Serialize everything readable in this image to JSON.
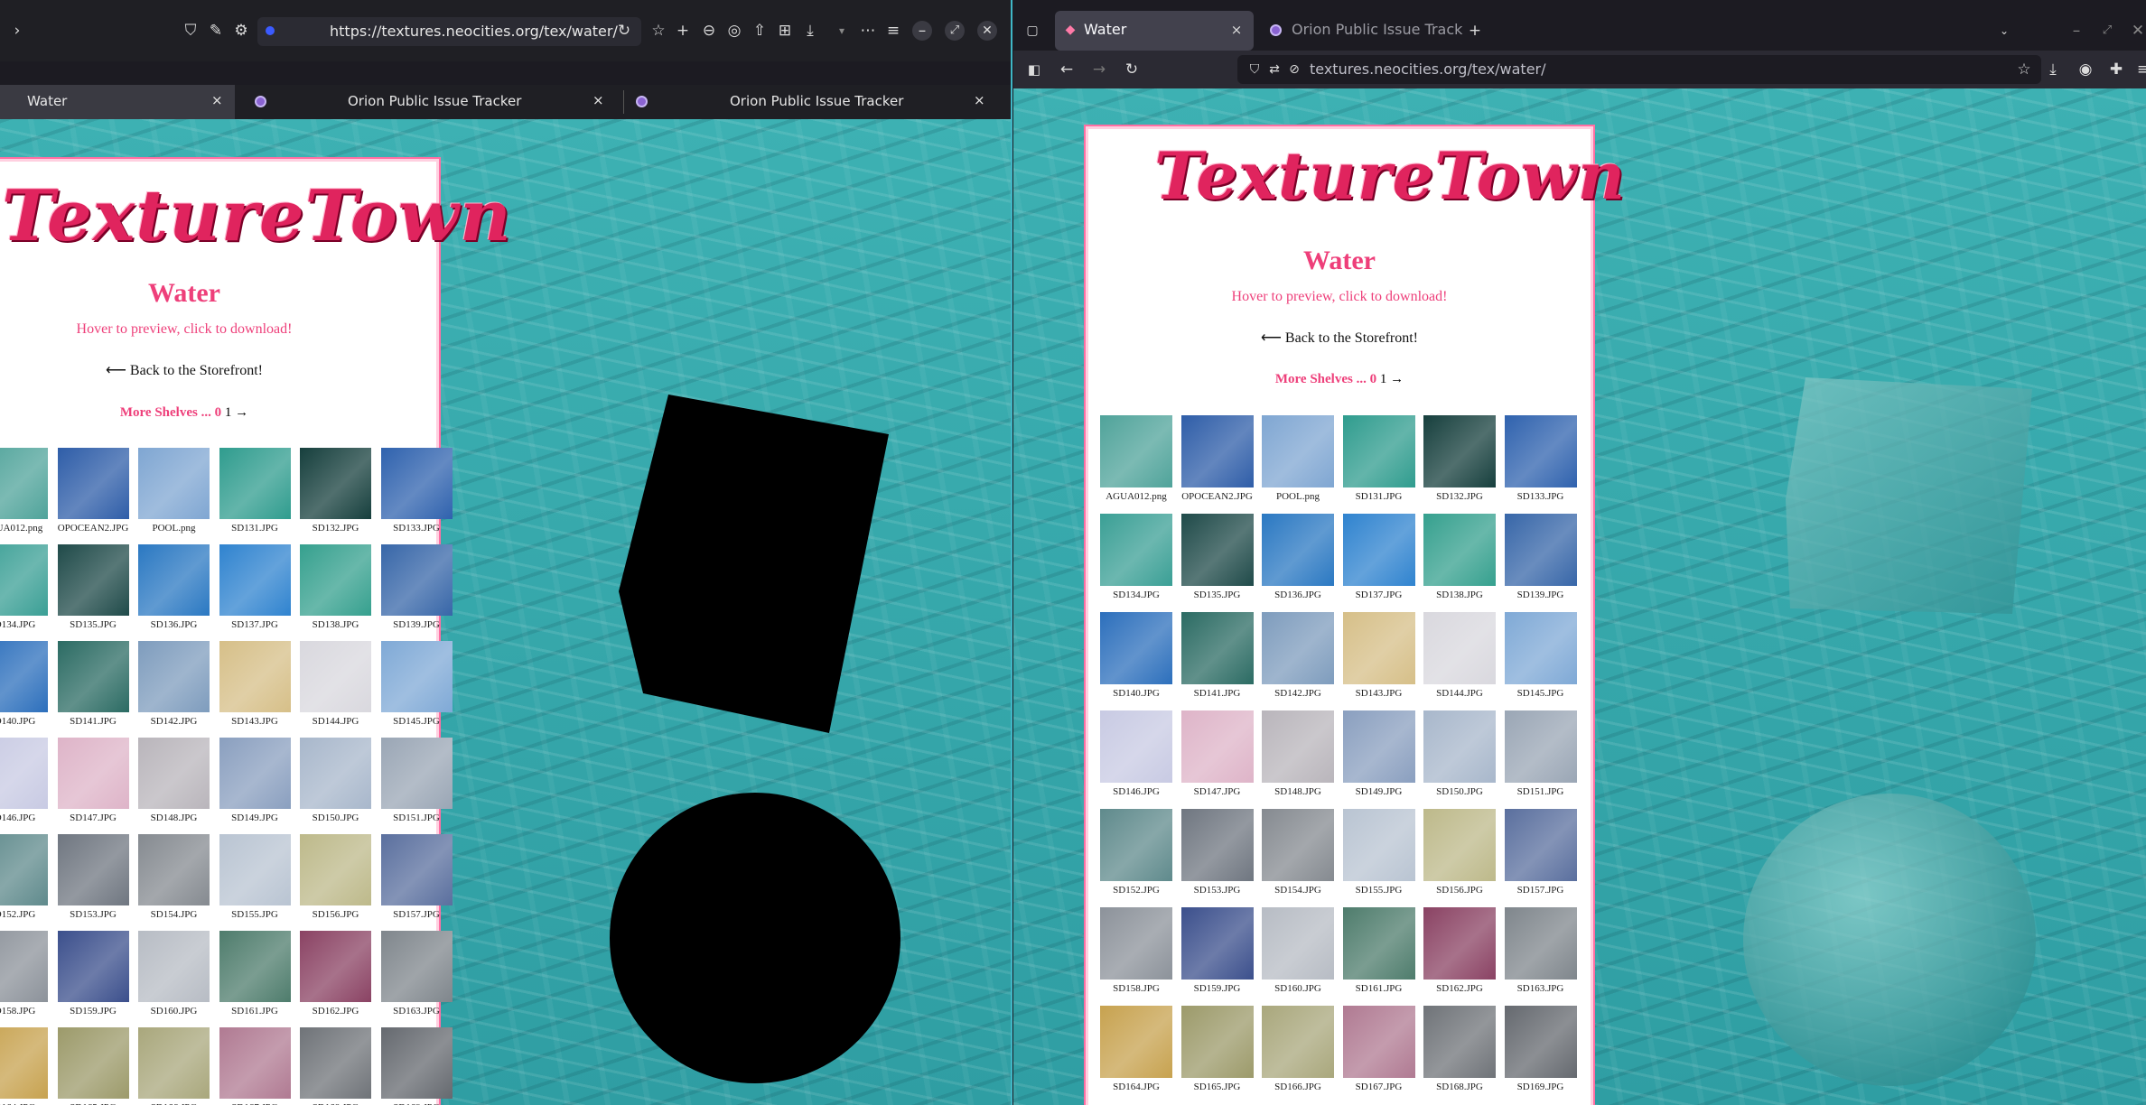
{
  "left_window": {
    "address": "https://textures.neocities.org/tex/water/",
    "tabs": [
      {
        "label": "Water",
        "close": "×"
      },
      {
        "label": "Orion Public Issue Tracker",
        "close": "×"
      },
      {
        "label": "Orion Public Issue Tracker",
        "close": "×"
      }
    ]
  },
  "right_window": {
    "tabs": [
      {
        "label": "Water",
        "close": "×"
      },
      {
        "label": "Orion Public Issue Track",
        "close": ""
      }
    ],
    "new_tab": "+",
    "address": "textures.neocities.org/tex/water/"
  },
  "page": {
    "logo": "TextureTown",
    "title": "Water",
    "hint": "Hover to preview, click to download!",
    "back_link": "⟵ Back to the Storefront!",
    "shelves_label": "More Shelves ... ",
    "shelf_current": "0",
    "shelf_next": "1",
    "shelf_arrow": "→"
  },
  "textures": [
    {
      "name": "AGUA012.png",
      "color": "#4fa39a"
    },
    {
      "name": "OPOCEAN2.JPG",
      "color": "#2e5da8"
    },
    {
      "name": "POOL.png",
      "color": "#7fa6d2"
    },
    {
      "name": "SD131.JPG",
      "color": "#2f9c8e"
    },
    {
      "name": "SD132.JPG",
      "color": "#163f3d"
    },
    {
      "name": "SD133.JPG",
      "color": "#2f62ae"
    },
    {
      "name": "SD134.JPG",
      "color": "#3a9f95"
    },
    {
      "name": "SD135.JPG",
      "color": "#1f4a49"
    },
    {
      "name": "SD136.JPG",
      "color": "#2a78c2"
    },
    {
      "name": "SD137.JPG",
      "color": "#2f83cf"
    },
    {
      "name": "SD138.JPG",
      "color": "#35a08e"
    },
    {
      "name": "SD139.JPG",
      "color": "#3766a8"
    },
    {
      "name": "SD140.JPG",
      "color": "#2c6fbc"
    },
    {
      "name": "SD141.JPG",
      "color": "#2b6b63"
    },
    {
      "name": "SD142.JPG",
      "color": "#7e9cbd"
    },
    {
      "name": "SD143.JPG",
      "color": "#d6bf88"
    },
    {
      "name": "SD144.JPG",
      "color": "#d9d8de"
    },
    {
      "name": "SD145.JPG",
      "color": "#7fa9d6"
    },
    {
      "name": "SD146.JPG",
      "color": "#c8cae3"
    },
    {
      "name": "SD147.JPG",
      "color": "#deb4c8"
    },
    {
      "name": "SD148.JPG",
      "color": "#b9b5bb"
    },
    {
      "name": "SD149.JPG",
      "color": "#8a9fbf"
    },
    {
      "name": "SD150.JPG",
      "color": "#a8b7cb"
    },
    {
      "name": "SD151.JPG",
      "color": "#9aa6b5"
    },
    {
      "name": "SD152.JPG",
      "color": "#5f8a8c"
    },
    {
      "name": "SD153.JPG",
      "color": "#6f7680"
    },
    {
      "name": "SD154.JPG",
      "color": "#858a90"
    },
    {
      "name": "SD155.JPG",
      "color": "#b9c4d2"
    },
    {
      "name": "SD156.JPG",
      "color": "#bdb98a"
    },
    {
      "name": "SD157.JPG",
      "color": "#5a6f9e"
    },
    {
      "name": "SD158.JPG",
      "color": "#8c929a"
    },
    {
      "name": "SD159.JPG",
      "color": "#3b4f8c"
    },
    {
      "name": "SD160.JPG",
      "color": "#b7bcc4"
    },
    {
      "name": "SD161.JPG",
      "color": "#4e7c6c"
    },
    {
      "name": "SD162.JPG",
      "color": "#8a4263"
    },
    {
      "name": "SD163.JPG",
      "color": "#7f868c"
    },
    {
      "name": "SD164.JPG",
      "color": "#c7a24f"
    },
    {
      "name": "SD165.JPG",
      "color": "#9c9a6a"
    },
    {
      "name": "SD166.JPG",
      "color": "#a9a77c"
    },
    {
      "name": "SD167.JPG",
      "color": "#b07a92"
    },
    {
      "name": "SD168.JPG",
      "color": "#6f7378"
    },
    {
      "name": "SD169.JPG",
      "color": "#65696f"
    }
  ]
}
